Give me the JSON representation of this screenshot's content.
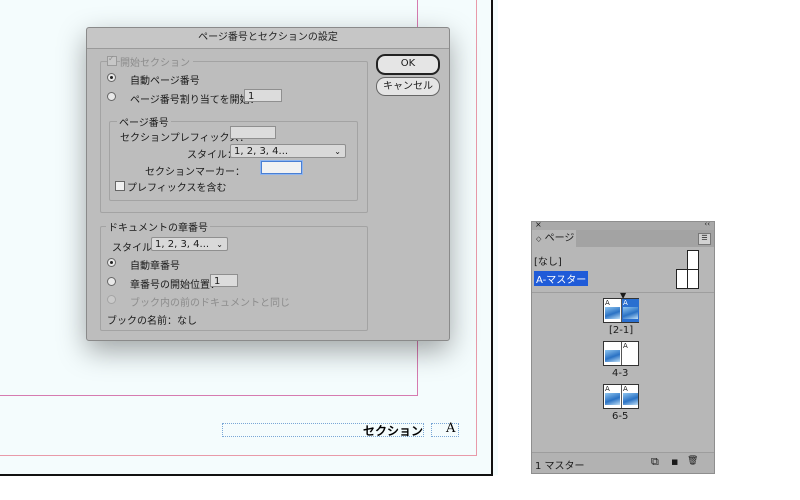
{
  "document": {
    "section_text": "セクション",
    "marker_text": "A"
  },
  "dialog": {
    "title": "ページ番号とセクションの設定",
    "start_section_label": "開始セクション",
    "auto_page_label": "自動ページ番号",
    "start_at_label": "ページ番号割り当てを開始：",
    "start_at_value": "1",
    "page_numbering_group": "ページ番号",
    "prefix_label": "セクションプレフィックス：",
    "prefix_value": "",
    "style_label": "スタイル：",
    "style_value": "1, 2, 3, 4...",
    "marker_label": "セクションマーカー：",
    "marker_value": "",
    "include_prefix_label": "プレフィックスを含む",
    "chapter_group": "ドキュメントの章番号",
    "chapter_style_label": "スタイル：",
    "chapter_style_value": "1, 2, 3, 4...",
    "auto_chapter_label": "自動章番号",
    "chapter_start_label": "章番号の開始位置：",
    "chapter_start_value": "1",
    "same_as_prev_label": "ブック内の前のドキュメントと同じ",
    "book_name_label": "ブックの名前：なし",
    "ok_label": "OK",
    "cancel_label": "キャンセル"
  },
  "pages_panel": {
    "tab_label": "ページ",
    "close_glyph": "×",
    "collapse_glyph": "‹‹",
    "menu_glyph": "☰",
    "master_none": "[なし]",
    "master_a": "A-マスター",
    "spreads": [
      {
        "label": "[2-1]",
        "left_letter": "A",
        "right_letter": "A"
      },
      {
        "label": "4-3",
        "left_letter": "",
        "right_letter": "A"
      },
      {
        "label": "6-5",
        "left_letter": "A",
        "right_letter": "A"
      }
    ],
    "footer_label": "1 マスター",
    "footer_icons": {
      "new_page": "⧉",
      "new_page_icon": "▪",
      "delete": "🗑"
    }
  },
  "colors": {
    "selection_blue": "#1f5bd8",
    "focus_ring": "#4a7fd3"
  }
}
